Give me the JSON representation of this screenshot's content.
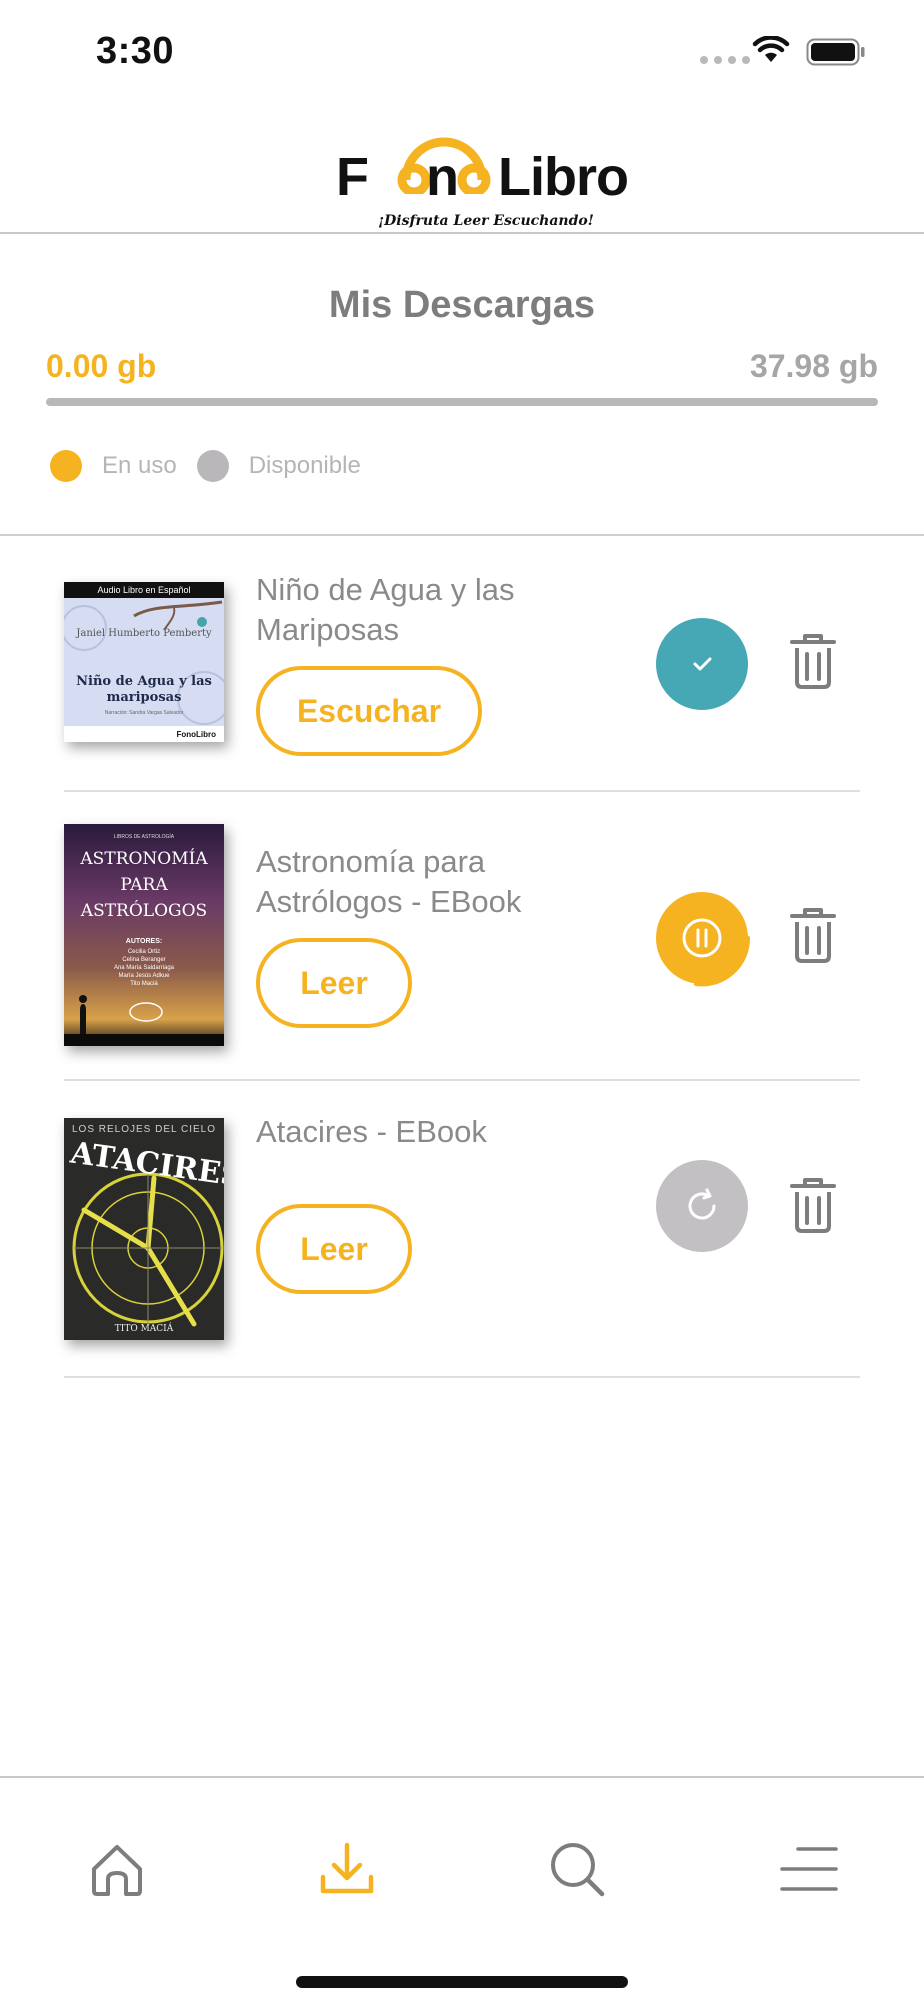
{
  "status_bar": {
    "time": "3:30"
  },
  "header": {
    "logo_text_left": "F",
    "logo_text_mid": "n",
    "logo_text_right": "Libro",
    "tagline": "¡Disfruta Leer Escuchando!"
  },
  "storage": {
    "title": "Mis Descargas",
    "used": "0.00 gb",
    "available": "37.98 gb",
    "used_fraction": 0,
    "legend_used": "En uso",
    "legend_available": "Disponible",
    "colors": {
      "used": "#f6b321",
      "available": "#b9b7b9"
    }
  },
  "books": [
    {
      "title": "Niño de Agua y las Mariposas",
      "action": "Escuchar",
      "status": "downloaded",
      "status_icon": "check-icon",
      "status_color": "#45a8b4",
      "cover": {
        "top_banner": "Audio Libro en Español",
        "author": "Janiel Humberto Pemberty",
        "title": "Niño de Agua y las mariposas",
        "small": "Narración: Sandra Vargas Salvador",
        "brand": "FonoLibro"
      }
    },
    {
      "title": "Astronomía para Astrólogos - EBook",
      "action": "Leer",
      "status": "downloading",
      "status_icon": "pause-icon",
      "status_color": "#f6b321",
      "cover": {
        "top_banner": "LIBROS DE ASTROLOGÍA",
        "title": "ASTRONOMÍA PARA ASTRÓLOGOS",
        "authors_label": "AUTORES:",
        "authors": [
          "Cecilia Ortiz",
          "Celina Beranger",
          "Ana María Saldarriaga",
          "María Jesús Adkue",
          "Tito Maciá"
        ]
      }
    },
    {
      "title": "Atacires - EBook",
      "action": "Leer",
      "status": "pending",
      "status_icon": "retry-icon",
      "status_color": "#c2c0c2",
      "cover": {
        "top_banner": "LOS RELOJES DEL CIELO",
        "title": "ATACIRES",
        "author": "TITO MACIÁ"
      }
    }
  ],
  "nav": {
    "items": [
      {
        "name": "home",
        "icon": "home-icon",
        "active": false
      },
      {
        "name": "downloads",
        "icon": "download-icon",
        "active": true
      },
      {
        "name": "search",
        "icon": "search-icon",
        "active": false
      },
      {
        "name": "menu",
        "icon": "menu-icon",
        "active": false
      }
    ],
    "active_color": "#f6b321",
    "inactive_color": "#7d7d7d"
  }
}
